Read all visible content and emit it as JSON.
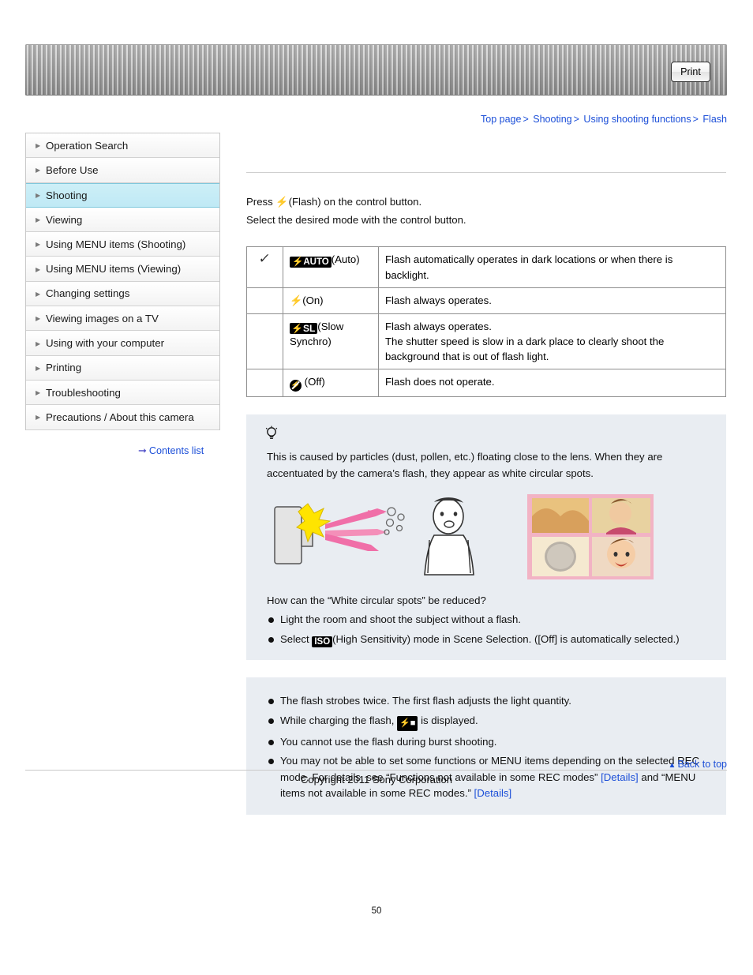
{
  "banner": {
    "print_label": "Print"
  },
  "breadcrumb": {
    "items": [
      "Top page",
      "Shooting",
      "Using shooting functions",
      "Flash"
    ],
    "separator": ">"
  },
  "sidebar": {
    "items": [
      {
        "label": "Operation Search",
        "active": false
      },
      {
        "label": "Before Use",
        "active": false
      },
      {
        "label": "Shooting",
        "active": true
      },
      {
        "label": "Viewing",
        "active": false
      },
      {
        "label": "Using MENU items (Shooting)",
        "active": false
      },
      {
        "label": "Using MENU items (Viewing)",
        "active": false
      },
      {
        "label": "Changing settings",
        "active": false
      },
      {
        "label": "Viewing images on a TV",
        "active": false
      },
      {
        "label": "Using with your computer",
        "active": false
      },
      {
        "label": "Printing",
        "active": false
      },
      {
        "label": "Troubleshooting",
        "active": false
      },
      {
        "label": "Precautions / About this camera",
        "active": false
      }
    ],
    "contents_list_label": "Contents list"
  },
  "main": {
    "intro_line1_pre": "Press ",
    "intro_line1_post": "(Flash) on the control button.",
    "intro_line2": "Select the desired mode with the control button.",
    "table": {
      "rows": [
        {
          "checked": true,
          "icon": "flash-auto-icon",
          "badge": "AUTO",
          "mode": "(Auto)",
          "description": "Flash automatically operates in dark locations or when there is backlight."
        },
        {
          "checked": false,
          "icon": "flash-on-icon",
          "badge": "",
          "mode": "(On)",
          "description": "Flash always operates."
        },
        {
          "checked": false,
          "icon": "flash-slow-synchro-icon",
          "badge": "SL",
          "mode": "(Slow Synchro)",
          "description": "Flash always operates.\nThe shutter speed is slow in a dark place to clearly shoot the background that is out of flash light."
        },
        {
          "checked": false,
          "icon": "flash-off-icon",
          "badge": "",
          "mode": "(Off)",
          "description": "Flash does not operate."
        }
      ]
    },
    "tip_panel": {
      "icon": "lightbulb-icon",
      "paragraph": "This is caused by particles (dust, pollen, etc.) floating close to the lens. When they are accentuated by the camera’s flash, they appear as white circular spots.",
      "question": "How can the “White circular spots” be reduced?",
      "bullets": [
        {
          "pre": "Light the room and shoot the subject without a flash.",
          "icon": "",
          "post": ""
        },
        {
          "pre": "Select ",
          "icon": "ISO",
          "post": "(High Sensitivity) mode in Scene Selection. ([Off] is automatically selected.)"
        }
      ]
    },
    "note_panel": {
      "bullets": [
        "The flash strobes twice. The first flash adjusts the light quantity.",
        "While charging the flash,  is displayed.",
        "You cannot use the flash during burst shooting.",
        "You may not be able to set some functions or MENU items depending on the selected REC mode. For details, see “Functions not available in some REC modes” [Details] and “MENU items not available in some REC modes.” [Details]"
      ],
      "charging_prefix": "While charging the flash,",
      "charging_suffix": "is displayed.",
      "rec_text_1": "You may not be able to set some functions or MENU items depending on the selected REC",
      "rec_text_2a": "mode. For details, see “Functions not available in some REC modes” ",
      "rec_link_1": "[Details]",
      "rec_text_2b": " and “MENU",
      "rec_text_3a": "items not available in some REC modes.” ",
      "rec_link_2": "[Details]"
    }
  },
  "footer": {
    "back_to_top": "Back to top",
    "copyright": "Copyright 2011 Sony Corporation",
    "page_number": "50"
  }
}
